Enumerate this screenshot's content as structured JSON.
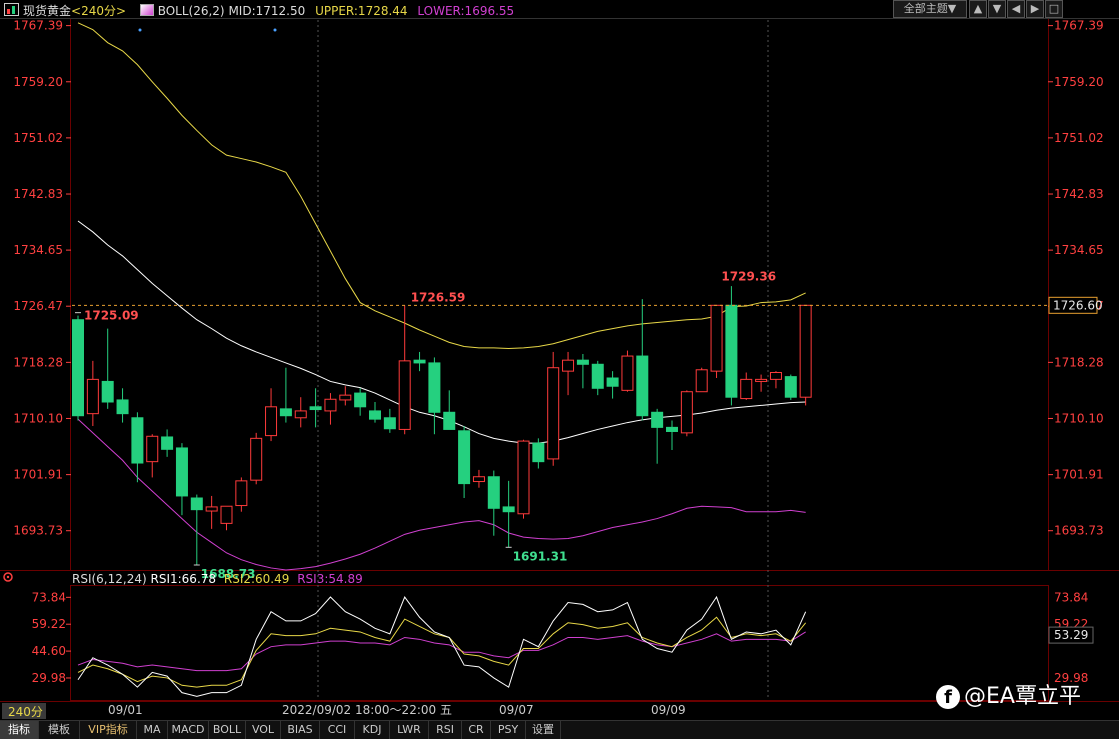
{
  "header": {
    "instrument": "现货黄金",
    "period": "<240分>",
    "indicator": "BOLL(26,2)",
    "mid": "MID:1712.50",
    "upper": "UPPER:1728.44",
    "lower": "LOWER:1696.55",
    "theme_button": "全部主题▼",
    "window_buttons": [
      "▲",
      "▼",
      "◀",
      "▶",
      "□"
    ]
  },
  "price_axis": {
    "ticks": [
      "1767.39",
      "1759.20",
      "1751.02",
      "1742.83",
      "1734.65",
      "1726.47",
      "1718.28",
      "1710.10",
      "1701.91",
      "1693.73"
    ],
    "ticks_right": [
      "1767.39",
      "1759.20",
      "1751.02",
      "1742.83",
      "1734.65",
      "1726.47",
      "1718.28",
      "1710.10",
      "1701.91",
      "1693.73"
    ],
    "current_price": "1726.60"
  },
  "annotations": {
    "high_left": "1725.09",
    "mid_high": "1726.59",
    "right_high": "1729.36",
    "low_left": "1688.73",
    "low_mid": "1691.31"
  },
  "rsi": {
    "title": "RSI(6,12,24)",
    "rsi1": "RSI1:66.78",
    "rsi2": "RSI2:60.49",
    "rsi3": "RSI3:54.89",
    "ticks": [
      "73.84",
      "59.22",
      "44.60",
      "29.98"
    ],
    "ticks_right": [
      "73.84",
      "59.22",
      "53.29",
      "29.98"
    ]
  },
  "time_axis": {
    "period_label": "240分",
    "labels": [
      "09/01",
      "2022/09/02 18:00～22:00 五",
      "09/07",
      "09/09"
    ]
  },
  "tabs": [
    "指标",
    "模板",
    "VIP指标",
    "MA",
    "MACD",
    "BOLL",
    "VOL",
    "BIAS",
    "CCI",
    "KDJ",
    "LWR",
    "RSI",
    "CR",
    "PSY",
    "设置"
  ],
  "watermark": "@EA覃立平",
  "colors": {
    "up": "#ff3b3b",
    "down": "#25d07f",
    "mid_line": "#ffffff",
    "upper_line": "#e8d848",
    "lower_line": "#d040d0",
    "rsi1": "#ffffff",
    "rsi2": "#e8d848",
    "rsi3": "#d040d0",
    "axis_text": "#ff4040"
  },
  "chart_data": {
    "type": "candlestick",
    "ylim": [
      1688.0,
      1768.5
    ],
    "candles": [
      {
        "o": 1724.5,
        "h": 1725.1,
        "l": 1709.8,
        "c": 1710.5
      },
      {
        "o": 1710.8,
        "h": 1718.5,
        "l": 1709.0,
        "c": 1715.8
      },
      {
        "o": 1715.5,
        "h": 1723.2,
        "l": 1711.5,
        "c": 1712.5
      },
      {
        "o": 1712.8,
        "h": 1714.5,
        "l": 1709.5,
        "c": 1710.8
      },
      {
        "o": 1710.2,
        "h": 1711.0,
        "l": 1700.8,
        "c": 1703.6
      },
      {
        "o": 1703.8,
        "h": 1707.8,
        "l": 1701.5,
        "c": 1707.5
      },
      {
        "o": 1707.4,
        "h": 1708.5,
        "l": 1704.5,
        "c": 1705.6
      },
      {
        "o": 1705.8,
        "h": 1706.5,
        "l": 1696.0,
        "c": 1698.8
      },
      {
        "o": 1698.5,
        "h": 1699.0,
        "l": 1688.7,
        "c": 1696.8
      },
      {
        "o": 1696.6,
        "h": 1698.8,
        "l": 1694.0,
        "c": 1697.2
      },
      {
        "o": 1694.8,
        "h": 1697.0,
        "l": 1693.8,
        "c": 1697.3
      },
      {
        "o": 1697.4,
        "h": 1701.5,
        "l": 1696.5,
        "c": 1701.0
      },
      {
        "o": 1701.1,
        "h": 1708.0,
        "l": 1700.5,
        "c": 1707.2
      },
      {
        "o": 1707.6,
        "h": 1714.5,
        "l": 1706.8,
        "c": 1711.8
      },
      {
        "o": 1711.5,
        "h": 1717.5,
        "l": 1709.5,
        "c": 1710.5
      },
      {
        "o": 1710.2,
        "h": 1713.2,
        "l": 1708.8,
        "c": 1711.2
      },
      {
        "o": 1711.8,
        "h": 1714.5,
        "l": 1708.8,
        "c": 1711.4
      },
      {
        "o": 1711.2,
        "h": 1713.8,
        "l": 1709.2,
        "c": 1712.9
      },
      {
        "o": 1712.8,
        "h": 1714.8,
        "l": 1712.0,
        "c": 1713.5
      },
      {
        "o": 1713.8,
        "h": 1714.5,
        "l": 1710.5,
        "c": 1711.8
      },
      {
        "o": 1711.2,
        "h": 1712.5,
        "l": 1709.5,
        "c": 1710.0
      },
      {
        "o": 1710.2,
        "h": 1711.5,
        "l": 1708.0,
        "c": 1708.6
      },
      {
        "o": 1708.5,
        "h": 1726.6,
        "l": 1707.8,
        "c": 1718.5
      },
      {
        "o": 1718.6,
        "h": 1719.8,
        "l": 1717.0,
        "c": 1718.2
      },
      {
        "o": 1718.2,
        "h": 1719.0,
        "l": 1707.8,
        "c": 1711.0
      },
      {
        "o": 1711.0,
        "h": 1714.2,
        "l": 1708.5,
        "c": 1708.5
      },
      {
        "o": 1708.3,
        "h": 1709.0,
        "l": 1698.5,
        "c": 1700.6
      },
      {
        "o": 1700.9,
        "h": 1702.6,
        "l": 1700.0,
        "c": 1701.6
      },
      {
        "o": 1701.6,
        "h": 1702.5,
        "l": 1693.0,
        "c": 1697.0
      },
      {
        "o": 1697.2,
        "h": 1701.0,
        "l": 1691.3,
        "c": 1696.5
      },
      {
        "o": 1696.2,
        "h": 1707.0,
        "l": 1695.5,
        "c": 1706.8
      },
      {
        "o": 1706.5,
        "h": 1707.2,
        "l": 1702.8,
        "c": 1703.8
      },
      {
        "o": 1704.2,
        "h": 1719.8,
        "l": 1703.2,
        "c": 1717.5
      },
      {
        "o": 1717.0,
        "h": 1719.8,
        "l": 1713.5,
        "c": 1718.6
      },
      {
        "o": 1718.6,
        "h": 1719.5,
        "l": 1714.5,
        "c": 1718.0
      },
      {
        "o": 1718.0,
        "h": 1718.5,
        "l": 1713.5,
        "c": 1714.5
      },
      {
        "o": 1716.0,
        "h": 1717.0,
        "l": 1713.0,
        "c": 1714.8
      },
      {
        "o": 1714.2,
        "h": 1720.0,
        "l": 1714.0,
        "c": 1719.2
      },
      {
        "o": 1719.2,
        "h": 1727.5,
        "l": 1709.8,
        "c": 1710.5
      },
      {
        "o": 1711.0,
        "h": 1711.5,
        "l": 1703.5,
        "c": 1708.8
      },
      {
        "o": 1708.8,
        "h": 1709.8,
        "l": 1705.5,
        "c": 1708.2
      },
      {
        "o": 1708.0,
        "h": 1714.2,
        "l": 1707.5,
        "c": 1714.0
      },
      {
        "o": 1714.0,
        "h": 1717.5,
        "l": 1714.0,
        "c": 1717.2
      },
      {
        "o": 1717.0,
        "h": 1723.0,
        "l": 1716.0,
        "c": 1726.6
      },
      {
        "o": 1726.6,
        "h": 1729.4,
        "l": 1712.0,
        "c": 1713.2
      },
      {
        "o": 1713.0,
        "h": 1716.8,
        "l": 1712.8,
        "c": 1715.8
      },
      {
        "o": 1715.5,
        "h": 1716.5,
        "l": 1714.0,
        "c": 1715.8
      },
      {
        "o": 1715.8,
        "h": 1717.0,
        "l": 1714.5,
        "c": 1716.8
      },
      {
        "o": 1716.2,
        "h": 1716.5,
        "l": 1712.8,
        "c": 1713.2
      },
      {
        "o": 1713.2,
        "h": 1726.6,
        "l": 1712.0,
        "c": 1726.6
      }
    ],
    "mid": [
      1738.9,
      1737.3,
      1735.4,
      1733.8,
      1731.8,
      1729.8,
      1728.0,
      1726.2,
      1724.5,
      1723.2,
      1721.8,
      1720.7,
      1719.8,
      1719.0,
      1718.2,
      1717.4,
      1716.5,
      1715.5,
      1715.0,
      1714.6,
      1713.8,
      1712.8,
      1711.8,
      1711.0,
      1710.5,
      1709.8,
      1708.9,
      1707.9,
      1707.2,
      1706.8,
      1706.5,
      1706.5,
      1706.8,
      1707.3,
      1707.9,
      1708.5,
      1709.0,
      1709.5,
      1709.9,
      1710.2,
      1710.4,
      1710.6,
      1710.9,
      1711.3,
      1711.6,
      1711.8,
      1712.0,
      1712.2,
      1712.4,
      1712.5
    ],
    "upper": [
      1767.8,
      1766.8,
      1764.9,
      1763.7,
      1761.7,
      1759.2,
      1756.8,
      1754.3,
      1752.1,
      1750.0,
      1748.5,
      1748.0,
      1747.5,
      1746.8,
      1746.0,
      1742.5,
      1738.5,
      1734.5,
      1730.5,
      1727.0,
      1725.8,
      1724.9,
      1724.0,
      1723.0,
      1722.1,
      1721.2,
      1720.6,
      1720.4,
      1720.4,
      1720.3,
      1720.4,
      1720.6,
      1721.0,
      1721.6,
      1722.2,
      1722.8,
      1723.2,
      1723.6,
      1723.9,
      1724.1,
      1724.3,
      1724.5,
      1724.6,
      1725.0,
      1726.4,
      1726.5,
      1727.0,
      1727.1,
      1727.4,
      1728.4
    ],
    "lower": [
      1710.0,
      1708.0,
      1706.0,
      1704.0,
      1701.5,
      1699.5,
      1697.5,
      1695.5,
      1693.5,
      1692.0,
      1690.5,
      1689.5,
      1688.8,
      1688.3,
      1688.0,
      1688.2,
      1688.5,
      1689.0,
      1689.6,
      1690.3,
      1691.2,
      1692.2,
      1693.2,
      1693.8,
      1694.2,
      1694.6,
      1695.0,
      1695.2,
      1694.6,
      1693.4,
      1692.8,
      1692.6,
      1692.5,
      1692.6,
      1693.0,
      1693.6,
      1694.2,
      1694.6,
      1695.0,
      1695.5,
      1696.2,
      1697.0,
      1697.3,
      1697.2,
      1697.1,
      1696.5,
      1696.5,
      1696.5,
      1696.7,
      1696.4
    ]
  },
  "rsi_data": {
    "ylim": [
      18.0,
      80.0
    ],
    "rsi1": [
      29,
      41,
      37,
      32,
      25,
      33,
      31,
      22,
      20,
      22,
      22,
      26,
      51,
      66,
      61,
      61,
      65,
      74,
      66,
      62,
      57,
      54,
      74,
      63,
      55,
      52,
      37,
      36,
      30,
      25,
      51,
      47,
      61,
      71,
      70,
      66,
      67,
      71,
      51,
      46,
      44,
      56,
      62,
      74,
      51,
      55,
      54,
      56,
      48,
      66
    ],
    "rsi2": [
      33,
      37,
      35,
      32,
      28,
      31,
      30,
      26,
      25,
      26,
      26,
      29,
      45,
      54,
      53,
      53,
      54,
      57,
      56,
      55,
      52,
      50,
      62,
      58,
      54,
      52,
      43,
      42,
      39,
      37,
      46,
      46,
      54,
      60,
      59,
      57,
      58,
      60,
      52,
      49,
      47,
      52,
      56,
      63,
      52,
      54,
      53,
      54,
      50,
      60
    ],
    "rsi3": [
      37,
      40,
      39,
      38,
      36,
      37,
      36,
      35,
      34,
      34,
      34,
      35,
      43,
      47,
      48,
      48,
      49,
      50,
      50,
      49,
      49,
      48,
      52,
      51,
      49,
      48,
      44,
      44,
      42,
      41,
      45,
      45,
      48,
      52,
      52,
      51,
      52,
      53,
      50,
      48,
      47,
      49,
      51,
      54,
      50,
      51,
      51,
      51,
      50,
      55
    ]
  }
}
